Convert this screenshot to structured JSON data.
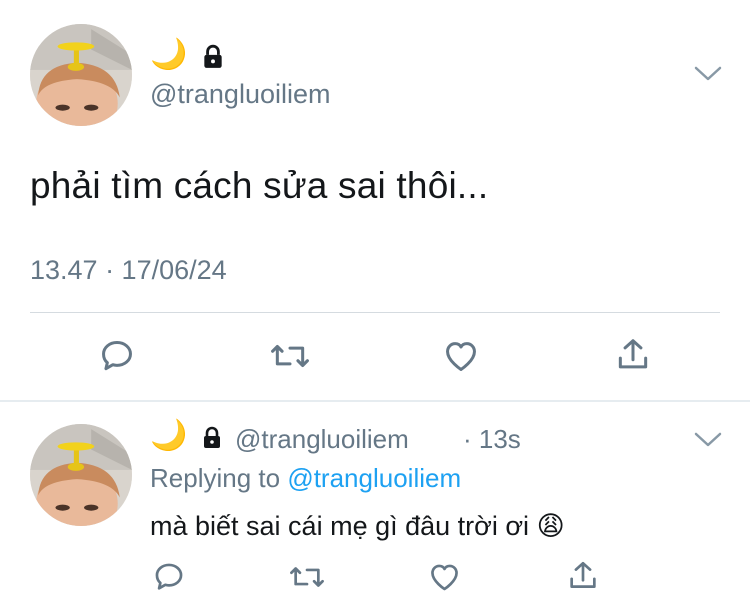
{
  "main_tweet": {
    "name_emoji": "🌙",
    "locked": true,
    "handle": "@trangluoiliem",
    "text": "phải tìm cách sửa sai thôi...",
    "timestamp": "13.47 · 17/06/24"
  },
  "actions": [
    "reply-icon",
    "retweet-icon",
    "like-icon",
    "share-icon"
  ],
  "reply_tweet": {
    "name_emoji": "🌙",
    "locked": true,
    "handle": "@trangluoiliem",
    "time": "· 13s",
    "replying_prefix": "Replying to",
    "replying_handle": "@trangluoiliem",
    "text": "mà biết sai cái mẹ gì đâu trời ơi",
    "emoji": "😩"
  },
  "colors": {
    "link": "#1da1f2",
    "secondary_text": "#657786",
    "icon": "#657786",
    "divider": "#d5dbe0"
  }
}
